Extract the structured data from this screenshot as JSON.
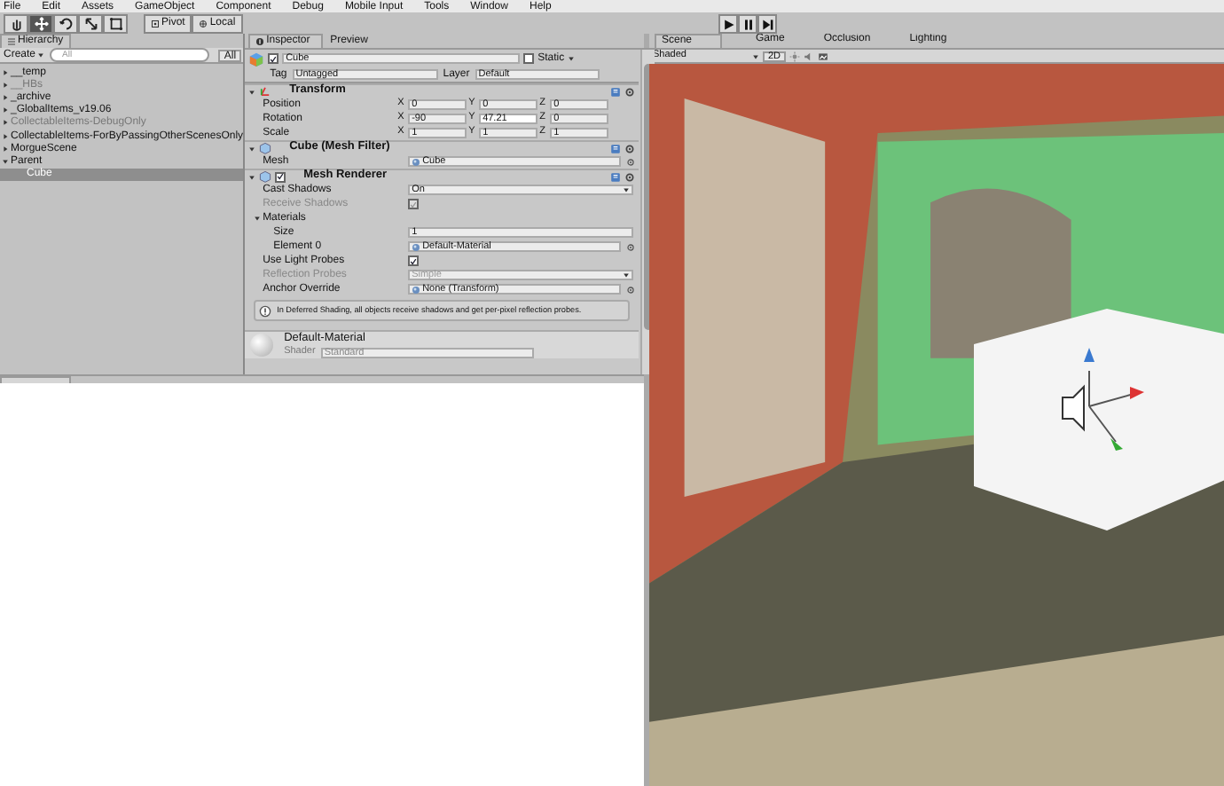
{
  "menu_bar": [
    "File",
    "Edit",
    "Assets",
    "GameObject",
    "Component",
    "Debug",
    "Mobile Input",
    "Tools",
    "Window",
    "Help"
  ],
  "toolbar": {
    "tools": [
      {
        "kind": "hand",
        "selected": false
      },
      {
        "kind": "move",
        "selected": true
      },
      {
        "kind": "rotate",
        "selected": false
      },
      {
        "kind": "scale",
        "selected": false
      },
      {
        "kind": "rect",
        "selected": false
      }
    ],
    "pivot": "Pivot",
    "space": "Local",
    "play_controls": [
      {
        "kind": "play"
      },
      {
        "kind": "pause"
      },
      {
        "kind": "step"
      }
    ]
  },
  "hierarchy": {
    "tab": "Hierarchy",
    "create": "Create",
    "search_placeholder": "All",
    "filter": "All",
    "items": [
      {
        "label": "__temp",
        "disabled": false,
        "selected": false,
        "expanded": false
      },
      {
        "label": "__HBs",
        "disabled": true,
        "selected": false,
        "expanded": false
      },
      {
        "label": "_archive",
        "disabled": false,
        "selected": false,
        "expanded": false
      },
      {
        "label": "_GlobalItems_v19.06",
        "disabled": false,
        "selected": false,
        "expanded": false
      },
      {
        "label": "CollectableItems-DebugOnly",
        "disabled": true,
        "selected": false,
        "expanded": false
      },
      {
        "label": "CollectableItems-ForByPassingOtherScenesOnly",
        "disabled": false,
        "selected": false,
        "expanded": false
      },
      {
        "label": "MorgueScene",
        "disabled": false,
        "selected": false,
        "expanded": false
      },
      {
        "label": "Parent",
        "disabled": false,
        "selected": false,
        "expanded": true,
        "children": [
          {
            "label": "Cube",
            "disabled": false,
            "selected": true
          }
        ]
      }
    ]
  },
  "inspector": {
    "tabs": [
      {
        "label": "Inspector",
        "selected": true
      },
      {
        "label": "Preview",
        "selected": false
      }
    ],
    "object": {
      "active": true,
      "name": "Cube",
      "static_label": "Static",
      "static": false,
      "tag_label": "Tag",
      "tag": "Untagged",
      "layer_label": "Layer",
      "layer": "Default"
    },
    "transform": {
      "title": "Transform",
      "rows": [
        {
          "label": "Position",
          "fields": [
            {
              "axis": "X",
              "value": "0",
              "focused": false
            },
            {
              "axis": "Y",
              "value": "0",
              "focused": false
            },
            {
              "axis": "Z",
              "value": "0",
              "focused": false
            }
          ]
        },
        {
          "label": "Rotation",
          "fields": [
            {
              "axis": "X",
              "value": "-90",
              "focused": false
            },
            {
              "axis": "Y",
              "value": "47.21",
              "focused": true
            },
            {
              "axis": "Z",
              "value": "0",
              "focused": false
            }
          ]
        },
        {
          "label": "Scale",
          "fields": [
            {
              "axis": "X",
              "value": "1",
              "focused": false
            },
            {
              "axis": "Y",
              "value": "1",
              "focused": false
            },
            {
              "axis": "Z",
              "value": "1",
              "focused": false
            }
          ]
        }
      ]
    },
    "mesh_filter": {
      "title": "Cube (Mesh Filter)",
      "mesh_label": "Mesh",
      "mesh": "Cube"
    },
    "mesh_renderer": {
      "title": "Mesh Renderer",
      "enabled": true,
      "properties": [
        {
          "kind": "dropdown",
          "label": "Cast Shadows",
          "value": "On",
          "disabled": false,
          "indent": false
        },
        {
          "kind": "checkbox",
          "label": "Receive Shadows",
          "checked": true,
          "disabled": true,
          "indent": false
        },
        {
          "kind": "foldout",
          "label": "Materials",
          "expanded": true,
          "disabled": false,
          "indent": false
        },
        {
          "kind": "field",
          "label": "Size",
          "value": "1",
          "disabled": false,
          "indent": true
        },
        {
          "kind": "object",
          "label": "Element 0",
          "value": "Default-Material",
          "disabled": false,
          "indent": true
        },
        {
          "kind": "checkbox",
          "label": "Use Light Probes",
          "checked": true,
          "disabled": false,
          "indent": false
        },
        {
          "kind": "dropdown",
          "label": "Reflection Probes",
          "value": "Simple",
          "disabled": true,
          "indent": false
        },
        {
          "kind": "object",
          "label": "Anchor Override",
          "value": "None (Transform)",
          "disabled": false,
          "indent": false
        }
      ],
      "info": "In Deferred Shading, all objects receive shadows and get per-pixel reflection probes."
    },
    "material": {
      "name": "Default-Material",
      "shader_label": "Shader",
      "shader": "Standard"
    }
  },
  "scene": {
    "tabs": [
      {
        "label": "Scene",
        "selected": true
      },
      {
        "label": "Game",
        "selected": false
      },
      {
        "label": "Occlusion",
        "selected": false
      },
      {
        "label": "Lighting",
        "selected": false
      }
    ],
    "shading": "Shaded",
    "mode_2d": "2D"
  }
}
